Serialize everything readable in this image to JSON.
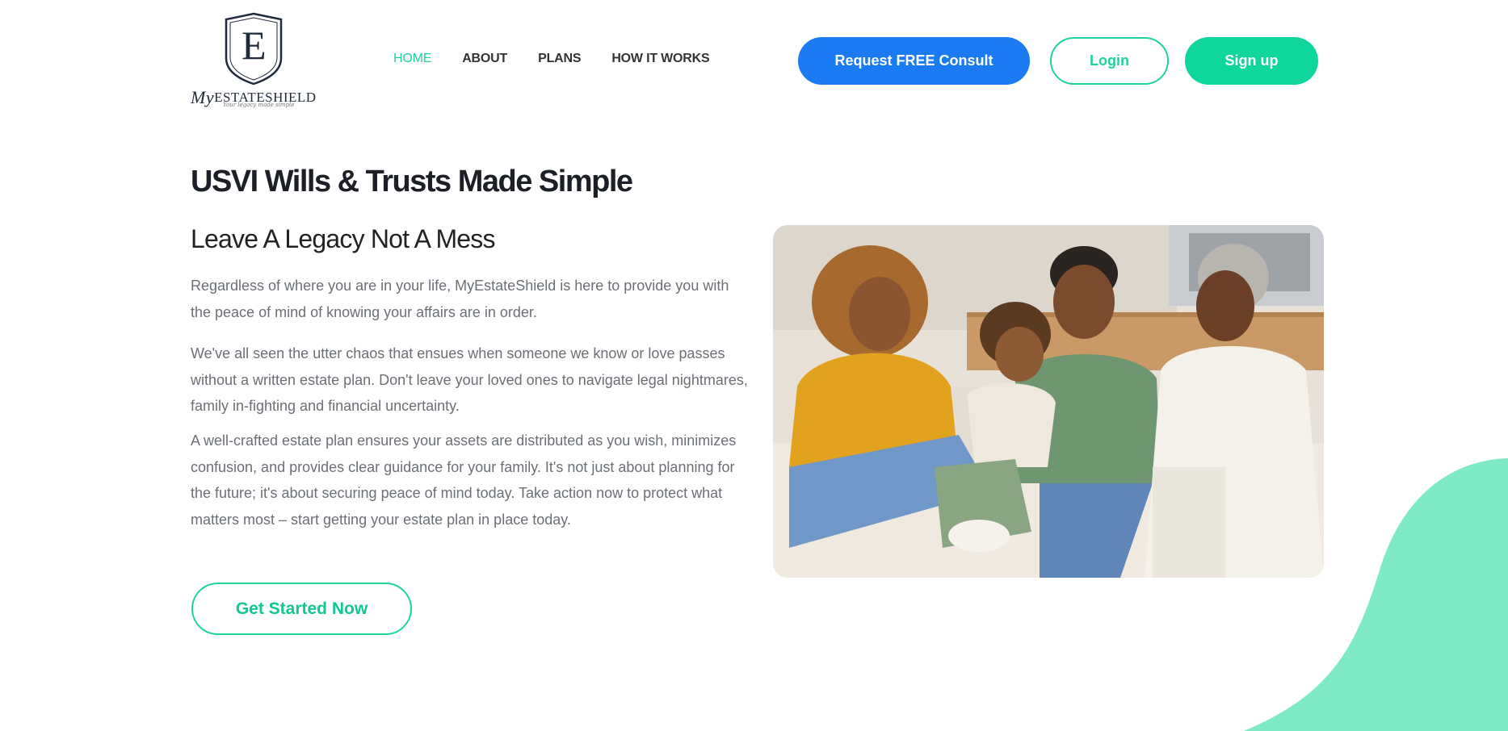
{
  "brand": {
    "prefix": "My",
    "name": "ESTATESHIELD",
    "tagline": "Your legacy made simple",
    "monogram": "E"
  },
  "nav": {
    "items": [
      {
        "label": "HOME",
        "active": true
      },
      {
        "label": "ABOUT",
        "active": false
      },
      {
        "label": "PLANS",
        "active": false
      },
      {
        "label": "HOW IT WORKS",
        "active": false
      }
    ]
  },
  "header_actions": {
    "consult_label": "Request FREE Consult",
    "login_label": "Login",
    "signup_label": "Sign up"
  },
  "hero": {
    "title": "USVI Wills & Trusts Made Simple",
    "subtitle": "Leave A Legacy Not A Mess",
    "paragraphs": [
      "Regardless of where you are in your life, MyEstateShield is here to provide you with the peace of mind of knowing your affairs are in order.",
      "We've all seen the utter chaos that ensues when someone we know or love passes without a written estate plan. Don't leave your loved ones to navigate legal nightmares, family in-fighting and financial uncertainty.",
      "A well-crafted estate plan ensures your assets are distributed as you wish, minimizes confusion, and provides clear guidance for your family. It's not just about planning for the future; it's about securing peace of mind today. Take action now to protect what matters most – start getting your estate plan in place today."
    ],
    "cta_label": "Get Started Now"
  },
  "colors": {
    "accent_green": "#1ed39d",
    "primary_blue": "#1a7bf2",
    "blob_green": "#7eebc4",
    "heading": "#1c1f26",
    "body_text": "#6b6f76"
  },
  "icons": {
    "logo": "shield-monogram-icon"
  }
}
